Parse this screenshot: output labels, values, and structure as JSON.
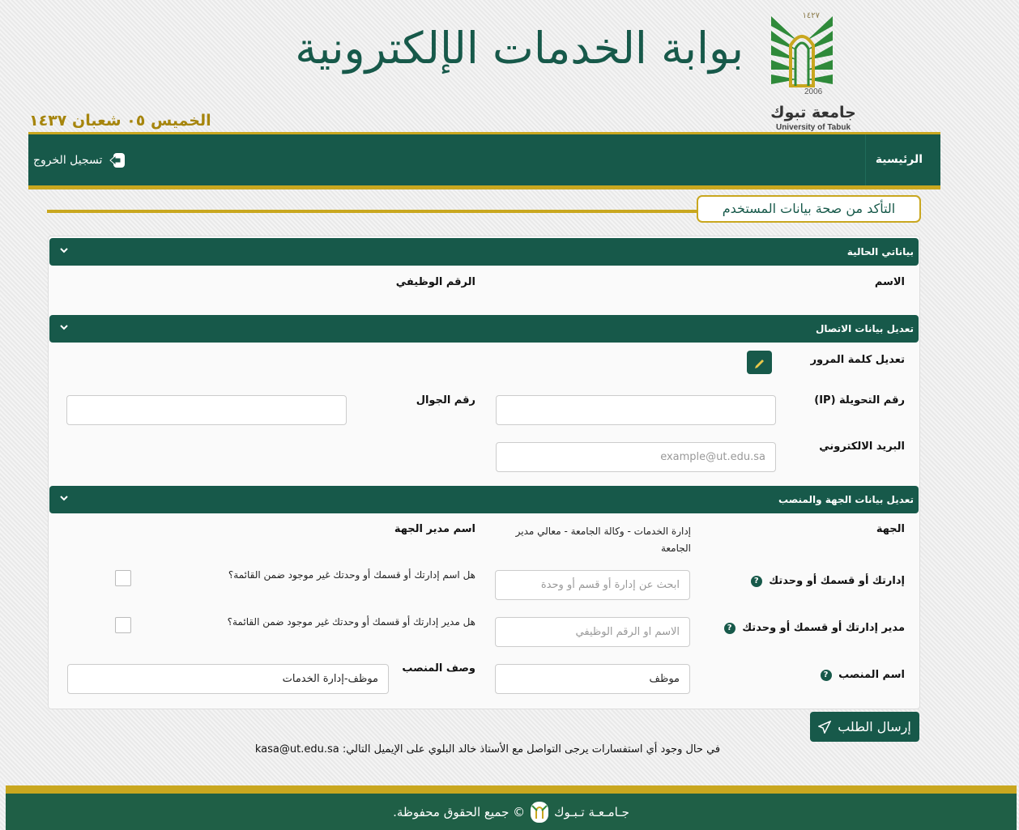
{
  "header": {
    "site_title": "بوابة الخدمات الإلكترونية",
    "hijri_date": "الخميس ٠٥ شعبان ١٤٣٧",
    "logo": {
      "year_hijri": "١٤٢٧",
      "year_greg": "2006",
      "name_ar": "جامعة تبوك",
      "name_en": "University of Tabuk"
    }
  },
  "nav": {
    "home": "الرئيسية",
    "logout": "تسجيل الخروج"
  },
  "page": {
    "heading": "التأكد من صحة بيانات المستخدم"
  },
  "sections": {
    "current": {
      "title": "بياناتي الحالية",
      "name_label": "الاسم",
      "job_number_label": "الرقم الوظيفي"
    },
    "contact": {
      "title": "تعديل بيانات الاتصال",
      "password_label": "تعديل كلمة المرور",
      "extension_label": "رقم التحويلة (IP)",
      "extension_value": "",
      "mobile_label": "رقم الجوال",
      "mobile_value": "",
      "email_label": "البريد الالكتروني",
      "email_placeholder": "example@ut.edu.sa"
    },
    "department": {
      "title": "تعديل بيانات الجهة والمنصب",
      "entity_label": "الجهة",
      "entity_value": "إدارة الخدمات - وكالة الجامعة - معالي مدير الجامعة",
      "entity_manager_label": "اسم مدير الجهة",
      "unit_label": "إدارتك أو قسمك أو وحدتك",
      "unit_placeholder": "ابحث عن إدارة أو قسم أو وحدة",
      "unit_missing_q": "هل اسم إدارتك أو قسمك أو وحدتك غير موجود ضمن القائمة؟",
      "unit_manager_label": "مدير إدارتك أو قسمك أو وحدتك",
      "unit_manager_placeholder": "الاسم او الرقم الوظيفي",
      "unit_manager_missing_q": "هل مدير إدارتك أو قسمك أو وحدتك غير موجود ضمن القائمة؟",
      "position_label": "اسم المنصب",
      "position_value": "موظف",
      "position_desc_label": "وصف المنصب",
      "position_desc_value": "موظف-إدارة الخدمات",
      "help_glyph": "?"
    }
  },
  "actions": {
    "submit": "إرسال الطلب"
  },
  "contact_note": "في حال وجود أي استفسارات يرجى التواصل مع الأستاذ خالد البلوي على الإيميل التالي: kasa@ut.edu.sa",
  "footer": {
    "text_left": "جـامـعـة تـبـوك",
    "text_right": "© جميع الحقوق محفوظة."
  },
  "icons": {
    "logout": "logout-icon",
    "chevron": "chevron-down-icon",
    "pencil": "pencil-icon",
    "send": "send-icon",
    "help": "help-icon"
  },
  "colors": {
    "primary": "#17594a",
    "accent": "#c9a71f",
    "title": "#17594a",
    "date": "#a6850d"
  }
}
